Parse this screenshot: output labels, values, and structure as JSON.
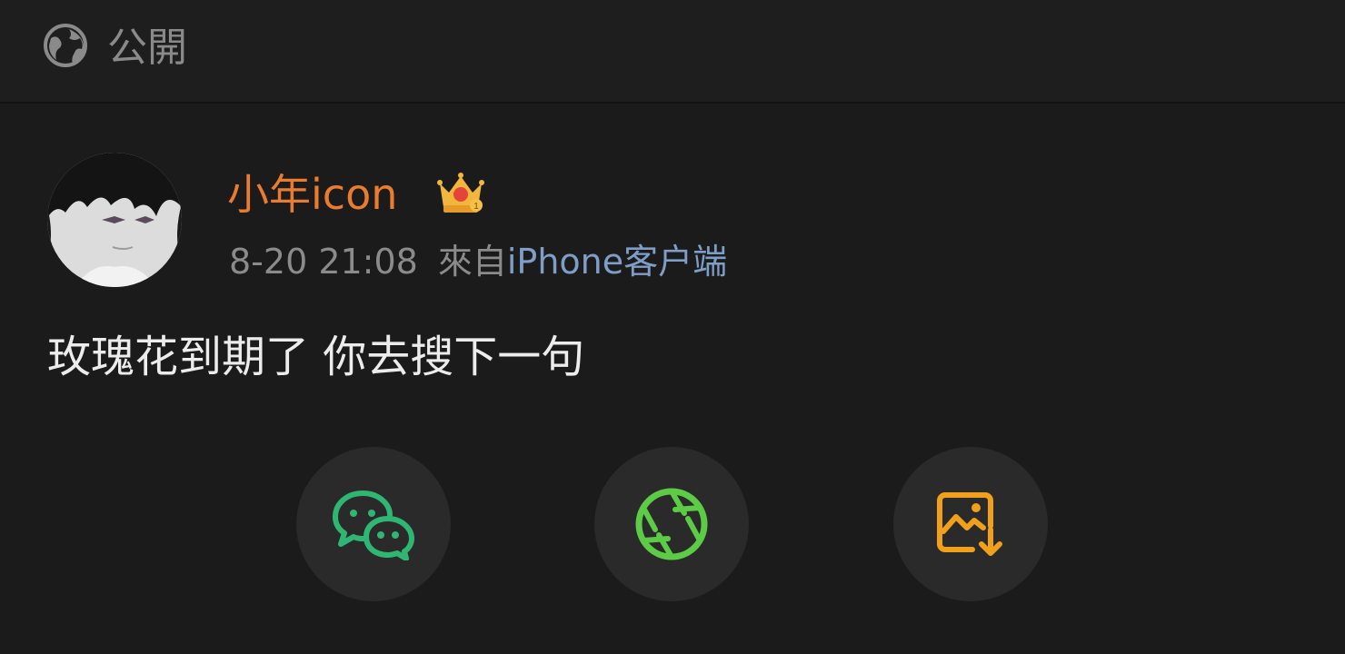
{
  "header": {
    "visibility_label": "公開",
    "visibility_icon": "globe-icon"
  },
  "post": {
    "author": "小年icon",
    "badge_icon": "crown-badge-icon",
    "timestamp": "8-20 21:08",
    "source_prefix": "來自",
    "source": "iPhone客户端",
    "text": "玫瑰花到期了 你去搜下一句"
  },
  "share": {
    "buttons": [
      {
        "icon": "wechat-icon",
        "color": "#2fb673"
      },
      {
        "icon": "moments-icon",
        "color": "#5ccb45"
      },
      {
        "icon": "save-image-icon",
        "color": "#f0a01a"
      }
    ]
  },
  "colors": {
    "background": "#1b1b1b",
    "author": "#ea7c2f",
    "source_link": "#7f9ec7",
    "text": "#ececec",
    "muted": "#8b8b8b"
  }
}
